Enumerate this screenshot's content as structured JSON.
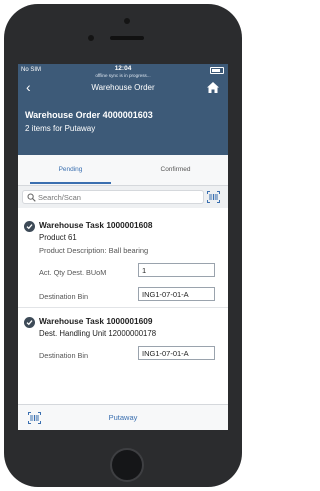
{
  "status_bar": {
    "carrier": "No SIM",
    "time": "12:04",
    "sync": "offline sync is in progress..."
  },
  "navbar": {
    "title": "Warehouse Order",
    "back_icon": "chevron-left-icon",
    "home_icon": "home-icon"
  },
  "object_header": {
    "title": "Warehouse Order 4000001603",
    "subtitle": "2 items for Putaway"
  },
  "tabs": [
    {
      "label": "Pending",
      "selected": true
    },
    {
      "label": "Confirmed",
      "selected": false
    }
  ],
  "search": {
    "placeholder": "Search/Scan",
    "value": ""
  },
  "tasks": [
    {
      "title": "Warehouse Task 1000001608",
      "line": "Product 61",
      "description": "Product Description: Ball bearing",
      "fields": [
        {
          "label": "Act. Qty Dest. BUoM",
          "value": "1"
        },
        {
          "label": "Destination Bin",
          "value": "ING1-07-01-A"
        }
      ]
    },
    {
      "title": "Warehouse Task 1000001609",
      "line": "Dest. Handling Unit 12000000178",
      "fields": [
        {
          "label": "Destination Bin",
          "value": "ING1-07-01-A"
        }
      ]
    }
  ],
  "footer": {
    "action_label": "Putaway",
    "scan_icon": "barcode-icon"
  },
  "colors": {
    "header": "#3d5a78",
    "accent": "#3a6fb0",
    "check": "#3d4a57"
  }
}
